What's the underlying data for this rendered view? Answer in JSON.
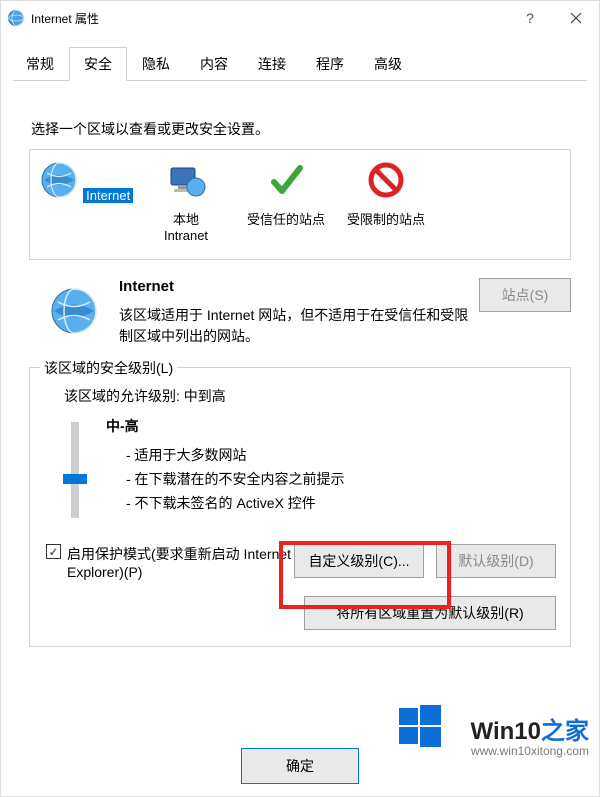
{
  "title": "Internet 属性",
  "help": "?",
  "tabs": [
    "常规",
    "安全",
    "隐私",
    "内容",
    "连接",
    "程序",
    "高级"
  ],
  "active_tab_index": 1,
  "instruction": "选择一个区域以查看或更改安全设置。",
  "zones": [
    {
      "label": "Internet",
      "selected": true
    },
    {
      "label": "本地\nIntranet",
      "selected": false
    },
    {
      "label": "受信任的站点",
      "selected": false
    },
    {
      "label": "受限制的站点",
      "selected": false
    }
  ],
  "zone_info": {
    "title": "Internet",
    "desc": "该区域适用于 Internet 网站，但不适用于在受信任和受限制区域中列出的网站。",
    "sites_btn": "站点(S)"
  },
  "security": {
    "fieldset_title": "该区域的安全级别(L)",
    "allowed_line": "该区域的允许级别: 中到高",
    "level_name": "中-高",
    "bullets": [
      "- 适用于大多数网站",
      "- 在下载潜在的不安全内容之前提示",
      "- 不下载未签名的 ActiveX 控件"
    ],
    "protect_label": "启用保护模式(要求重新启动 Internet Explorer)(P)",
    "custom_btn": "自定义级别(C)...",
    "default_btn": "默认级别(D)",
    "reset_all_btn": "将所有区域重置为默认级别(R)"
  },
  "ok_btn": "确定",
  "watermark": {
    "brand_main": "Win10",
    "brand_suffix": "之家",
    "url": "www.win10xitong.com"
  }
}
